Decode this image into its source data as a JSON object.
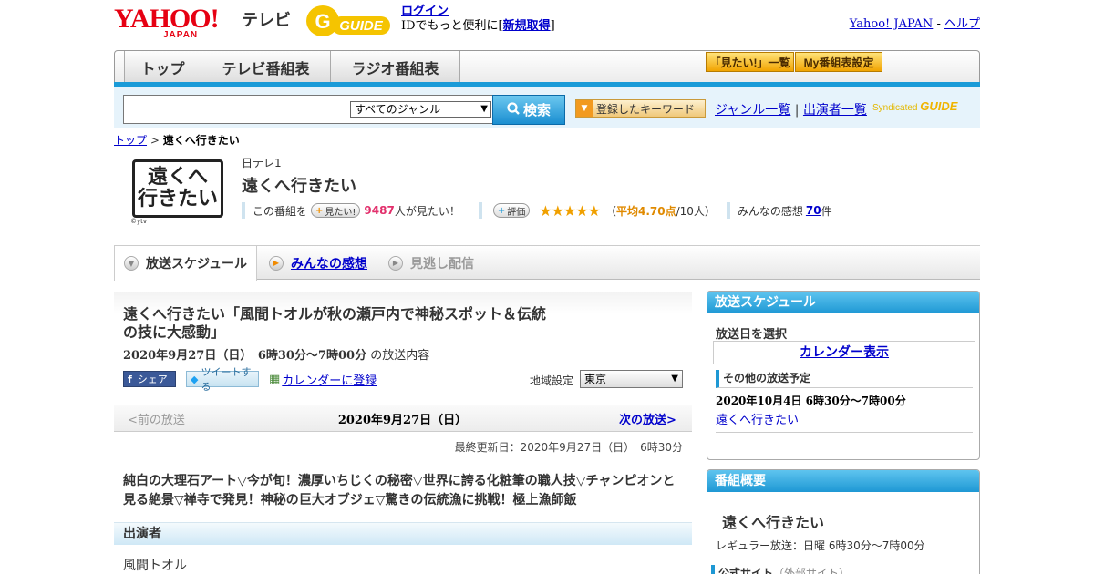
{
  "header": {
    "yahoo_logo": "YAHOO!",
    "yahoo_logo_sub": "JAPAN",
    "tv_label": "テレビ",
    "gguide_logo": "G-GUIDE",
    "login_link": "ログイン",
    "login_text": "IDでもっと便利に[",
    "signup_link": "新規取得",
    "login_text_end": "]",
    "yahoo_japan_link": "Yahoo! JAPAN",
    "dash": " - ",
    "help_link": "ヘルプ"
  },
  "nav": {
    "tabs": [
      "トップ",
      "テレビ番組表",
      "ラジオ番組表"
    ],
    "mitai_list": "「見たい!」一覧",
    "my_schedule": "My番組表設定"
  },
  "search": {
    "placeholder": "",
    "genre_value": "すべてのジャンル",
    "button_label": "検索",
    "keyword_button": "登録したキーワード",
    "genre_list_link": "ジャンル一覧",
    "divider": "|",
    "performer_list_link": "出演者一覧",
    "syndicated": "Syndicated",
    "syndicated_logo": "GUIDE"
  },
  "breadcrumb": {
    "top": "トップ",
    "separator": " > ",
    "current": "遠くへ行きたい"
  },
  "program": {
    "logo_line1": "遠くへ",
    "logo_line2": "行きたい",
    "logo_sub": "©ytv",
    "channel": "日テレ1",
    "title": "遠くへ行きたい",
    "mitai_prefix": "この番組を",
    "mitai_button": "見たい!",
    "mitai_count": "9487",
    "mitai_suffix": "人が見たい！",
    "rate_button": "評価",
    "rating_stars": "★★★★★",
    "rating_open": "（",
    "rating_avg": "平均4.70点",
    "rating_count": "/10人）",
    "reviews_prefix": "みんなの感想",
    "reviews_count": "70",
    "reviews_suffix": "件",
    "rating_value": 4.7
  },
  "tabs": {
    "schedule": "放送スケジュール",
    "reviews": "みんなの感想",
    "missed": "見逃し配信"
  },
  "episode": {
    "title": "遠くへ行きたい「風間トオルが秋の瀬戸内で神秘スポット＆伝統の技に大感動」",
    "date_time": "2020年9月27日（日）　6時30分～7時00分",
    "date_suffix": "の放送内容",
    "share_fb": "シェア",
    "tweet": "ツイートする",
    "calendar_register": "カレンダーに登録",
    "region_label": "地域設定",
    "region_value": "東京"
  },
  "pager": {
    "prev": "<前の放送",
    "date": "2020年9月27日（日）",
    "next": "次の放送>"
  },
  "updated": "最終更新日：2020年9月27日（日）　6時30分",
  "description": "純白の大理石アート▽今が旬！濃厚いちじくの秘密▽世界に誇る化粧筆の職人技▽チャンピオンと見る絶景▽禅寺で発見！神秘の巨大オブジェ▽驚きの伝統漁に挑戦！極上漁師飯",
  "cast": {
    "header": "出演者",
    "name": "風間トオル"
  },
  "sidebar": {
    "schedule_header": "放送スケジュール",
    "select_date": "放送日を選択",
    "calendar_link": "カレンダー表示",
    "other_header": "その他の放送予定",
    "other_date": "2020年10月4日 6時30分～7時00分",
    "other_link": "遠くへ行きたい",
    "summary_header": "番組概要",
    "summary_title": "遠くへ行きたい",
    "regular": "レギュラー放送：日曜 6時30分～7時00分",
    "official_site": "公式サイト",
    "external": "（外部サイト）"
  },
  "colors": {
    "accent_blue": "#1a9bd8",
    "yahoo_red": "#e60012",
    "link": "#0000cc",
    "star": "#f0a000"
  }
}
